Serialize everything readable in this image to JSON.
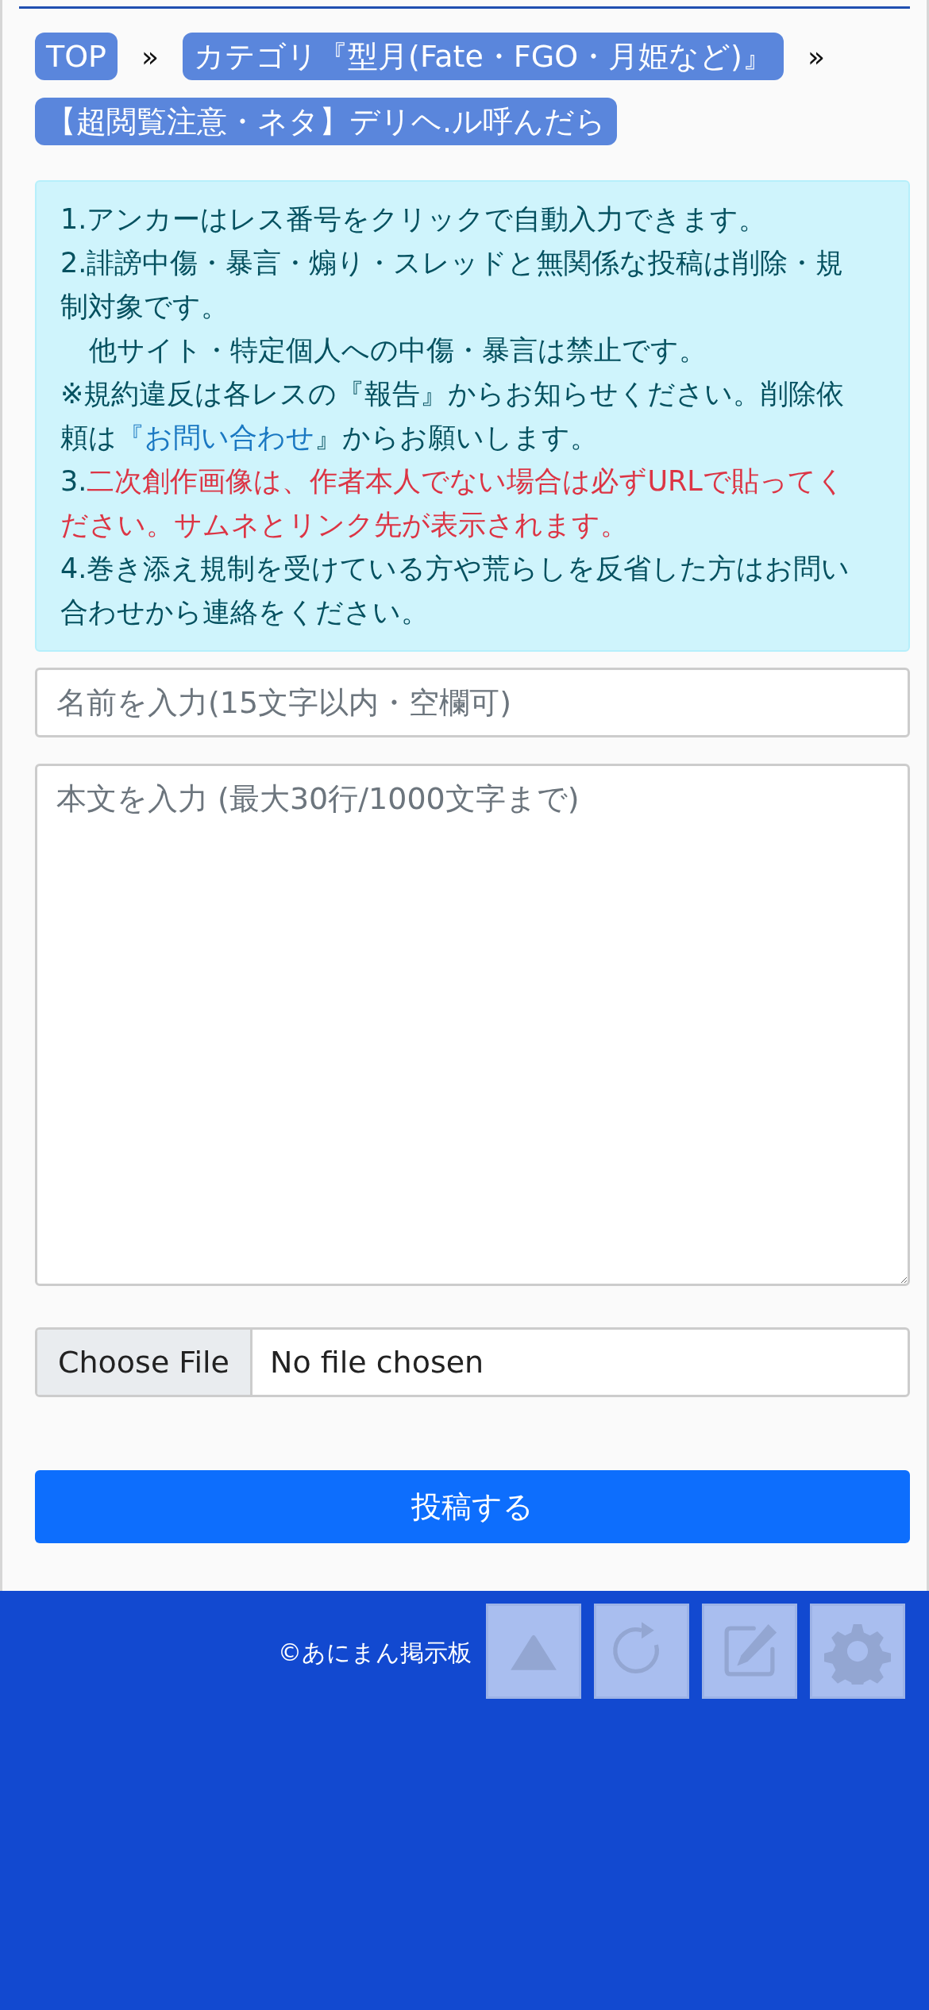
{
  "breadcrumb": {
    "items": [
      {
        "label": "TOP"
      },
      {
        "label": "カテゴリ『型月(Fate・FGO・月姫など)』"
      },
      {
        "label": "【超閲覧注意・ネタ】デリヘ.ル呼んだら"
      }
    ],
    "separator": "»"
  },
  "notice": {
    "paragraphs": [
      {
        "indent": false,
        "segments": [
          {
            "kind": "text",
            "text": "1.アンカーはレス番号をクリックで自動入力できます。"
          }
        ]
      },
      {
        "indent": false,
        "segments": [
          {
            "kind": "text",
            "text": "2.誹謗中傷・暴言・煽り・スレッドと無関係な投稿は削除・規制対象です。"
          }
        ]
      },
      {
        "indent": true,
        "segments": [
          {
            "kind": "text",
            "text": "他サイト・特定個人への中傷・暴言は禁止です。"
          }
        ]
      },
      {
        "indent": false,
        "segments": [
          {
            "kind": "text",
            "text": "※規約違反は各レスの『報告』からお知らせください。削除依頼は"
          },
          {
            "kind": "link",
            "text": "『お問い合わせ"
          },
          {
            "kind": "text",
            "text": "』からお願いします。"
          }
        ]
      },
      {
        "indent": false,
        "segments": [
          {
            "kind": "text",
            "text": "3."
          },
          {
            "kind": "alert",
            "text": "二次創作画像は、作者本人でない場合は必ずURLで貼ってください。サムネとリンク先が表示されます。"
          }
        ]
      },
      {
        "indent": false,
        "segments": [
          {
            "kind": "text",
            "text": "4.巻き添え規制を受けている方や荒らしを反省した方はお問い合わせから連絡をください。"
          }
        ]
      }
    ]
  },
  "form": {
    "name_field": {
      "placeholder": "名前を入力(15文字以内・空欄可)"
    },
    "body_field": {
      "placeholder": "本文を入力 (最大30行/1000文字まで)"
    },
    "file_input": {
      "button": "Choose File",
      "status": "No file chosen"
    },
    "submit": "投稿する"
  },
  "footer": {
    "copyright": "©あにまん掲示板"
  },
  "floating_buttons": [
    {
      "kind": "top"
    },
    {
      "kind": "reload"
    },
    {
      "kind": "write"
    },
    {
      "kind": "settings"
    }
  ]
}
